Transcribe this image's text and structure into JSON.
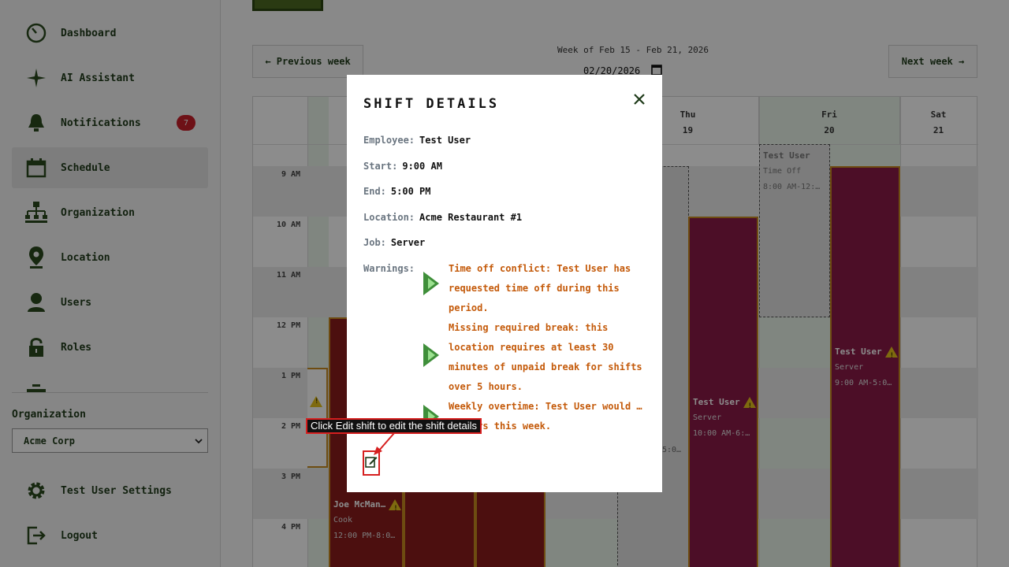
{
  "sidebar": {
    "items": [
      {
        "label": "Dashboard",
        "icon": "dashboard-icon"
      },
      {
        "label": "AI Assistant",
        "icon": "sparkle-icon"
      },
      {
        "label": "Notifications",
        "icon": "bell-icon",
        "badge": "7"
      },
      {
        "label": "Schedule",
        "icon": "calendar-icon",
        "active": true
      },
      {
        "label": "Organization",
        "icon": "org-chart-icon"
      },
      {
        "label": "Location",
        "icon": "location-pin-icon"
      },
      {
        "label": "Users",
        "icon": "user-icon"
      },
      {
        "label": "Roles",
        "icon": "lock-icon"
      }
    ],
    "organization_label": "Organization",
    "organization_selected": "Acme Corp",
    "settings_label": "Test User Settings",
    "logout_label": "Logout"
  },
  "schedule": {
    "prev_week": "← Previous week",
    "next_week": "Next week →",
    "week_caption": "Week of Feb 15 - Feb 21, 2026",
    "week_date": "02/20/2026",
    "days": [
      {
        "name": "Thu",
        "date": "19"
      },
      {
        "name": "Fri",
        "date": "20"
      },
      {
        "name": "Sat",
        "date": "21"
      }
    ],
    "times": [
      "9 AM",
      "10 AM",
      "11 AM",
      "12 PM",
      "1 PM",
      "2 PM",
      "3 PM",
      "4 PM"
    ],
    "shifts": {
      "joe": {
        "name": "Joe McMan…",
        "job": "Cook",
        "time": "12:00 PM-8:0…"
      },
      "thu": {
        "name": "Test User",
        "job": "Server",
        "time": "10:00 AM-6:…"
      },
      "fri_timeoff": {
        "name": "Test User",
        "kind": "Time Off",
        "time": "8:00 AM-12:…"
      },
      "fri": {
        "name": "Test User",
        "job": "Server",
        "time": "9:00 AM-5:0…"
      }
    },
    "partial_wed_time": "5:0…",
    "partial_small": "0…"
  },
  "modal": {
    "title": "SHIFT DETAILS",
    "employee_label": "Employee:",
    "employee": "Test User",
    "start_label": "Start:",
    "start": "9:00 AM",
    "end_label": "End:",
    "end": "5:00 PM",
    "location_label": "Location:",
    "location": "Acme Restaurant #1",
    "job_label": "Job:",
    "job": "Server",
    "warnings_label": "Warnings:",
    "warnings": [
      "Time off conflict: Test User has requested time off during this period.",
      "Missing required break: this location requires at least 30 minutes of unpaid break for shifts over 5 hours.",
      "Weekly overtime: Test User would … 0 hours this week."
    ]
  },
  "annotation": "Click Edit shift to edit the shift details",
  "colors": {
    "shift_red": "#8a1c1c",
    "shift_magenta": "#8a1a48",
    "warning_text": "#c45a0a",
    "accent_green": "#1f3b1a",
    "badge_red": "#c8202a"
  }
}
